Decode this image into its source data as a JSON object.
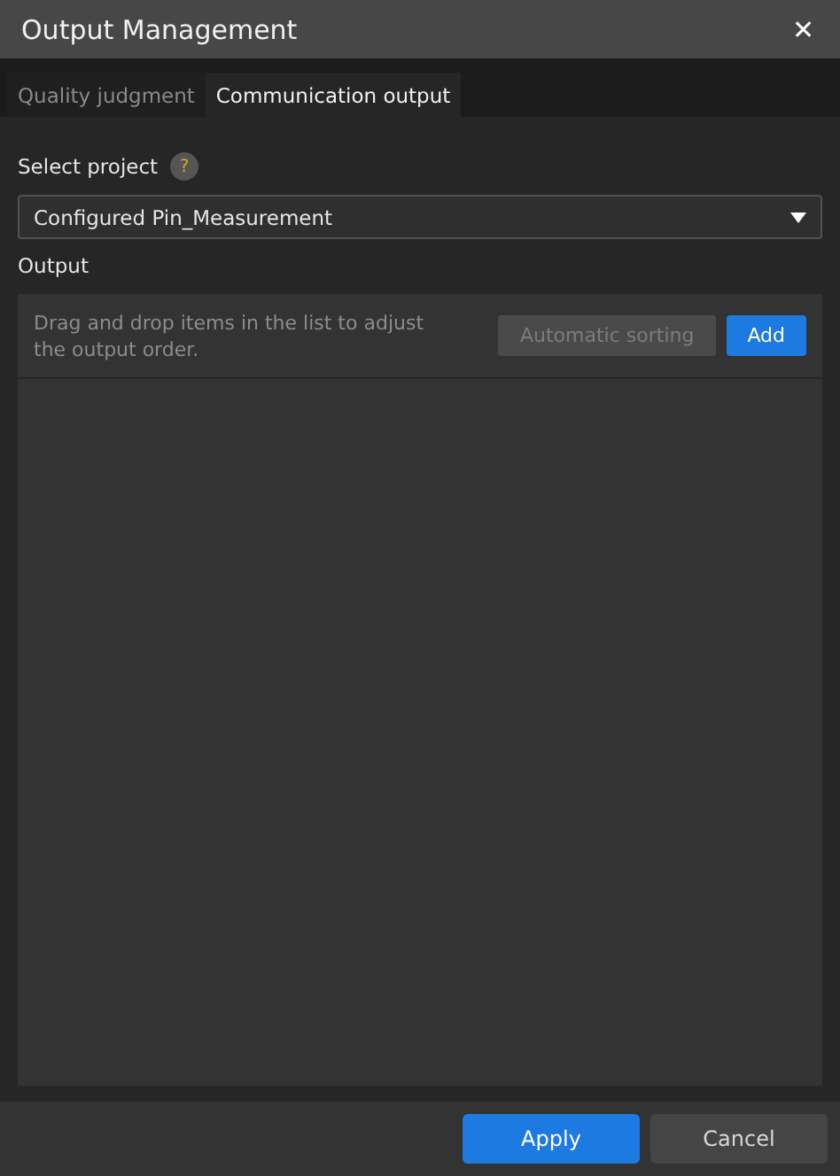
{
  "window": {
    "title": "Output Management",
    "close": "✕"
  },
  "tabs": [
    {
      "label": "Quality judgment",
      "selected": false
    },
    {
      "label": "Communication output",
      "selected": true
    }
  ],
  "project": {
    "label": "Select project",
    "help": "?",
    "value": "Configured Pin_Measurement"
  },
  "output": {
    "label": "Output",
    "hint": "Drag and drop items in the list to adjust the output order.",
    "buttons": [
      {
        "label": "Automatic sorting",
        "disabled": true
      },
      {
        "label": "Add",
        "disabled": false
      }
    ]
  },
  "footer": [
    {
      "label": "Apply",
      "kind": "primary"
    },
    {
      "label": "Cancel",
      "kind": "secondary"
    }
  ]
}
